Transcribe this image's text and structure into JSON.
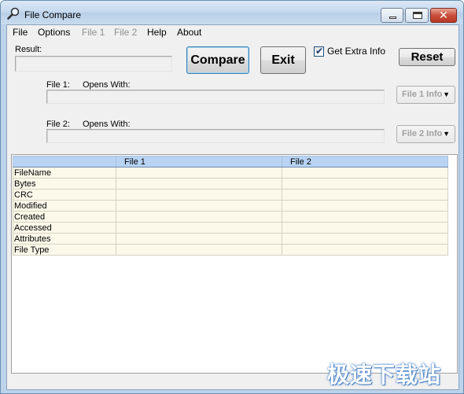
{
  "window": {
    "title": "File Compare"
  },
  "menu": [
    {
      "label": "File",
      "enabled": true
    },
    {
      "label": "Options",
      "enabled": true
    },
    {
      "label": "File 1",
      "enabled": false
    },
    {
      "label": "File 2",
      "enabled": false
    },
    {
      "label": "Help",
      "enabled": true
    },
    {
      "label": "About",
      "enabled": true
    }
  ],
  "result": {
    "label": "Result:",
    "value": ""
  },
  "buttons": {
    "compare": "Compare",
    "exit": "Exit",
    "reset": "Reset"
  },
  "extra_info": {
    "label": "Get Extra Info",
    "checked": true
  },
  "file1": {
    "label": "File 1:",
    "opens_with_label": "Opens With:",
    "path": "",
    "info_button": "File 1 Info"
  },
  "file2": {
    "label": "File 2:",
    "opens_with_label": "Opens With:",
    "path": "",
    "info_button": "File 2 Info"
  },
  "grid": {
    "columns": [
      "",
      "File 1",
      "File 2"
    ],
    "rows": [
      {
        "property": "FileName",
        "file1": "",
        "file2": ""
      },
      {
        "property": "Bytes",
        "file1": "",
        "file2": ""
      },
      {
        "property": "CRC",
        "file1": "",
        "file2": ""
      },
      {
        "property": "Modified",
        "file1": "",
        "file2": ""
      },
      {
        "property": "Created",
        "file1": "",
        "file2": ""
      },
      {
        "property": "Accessed",
        "file1": "",
        "file2": ""
      },
      {
        "property": "Attributes",
        "file1": "",
        "file2": ""
      },
      {
        "property": "File Type",
        "file1": "",
        "file2": ""
      }
    ]
  },
  "watermark": "极速下载站",
  "colors": {
    "grid_header": "#b8d3f3",
    "grid_cell": "#fcf9ea",
    "client_bg": "#f0f0f0"
  }
}
